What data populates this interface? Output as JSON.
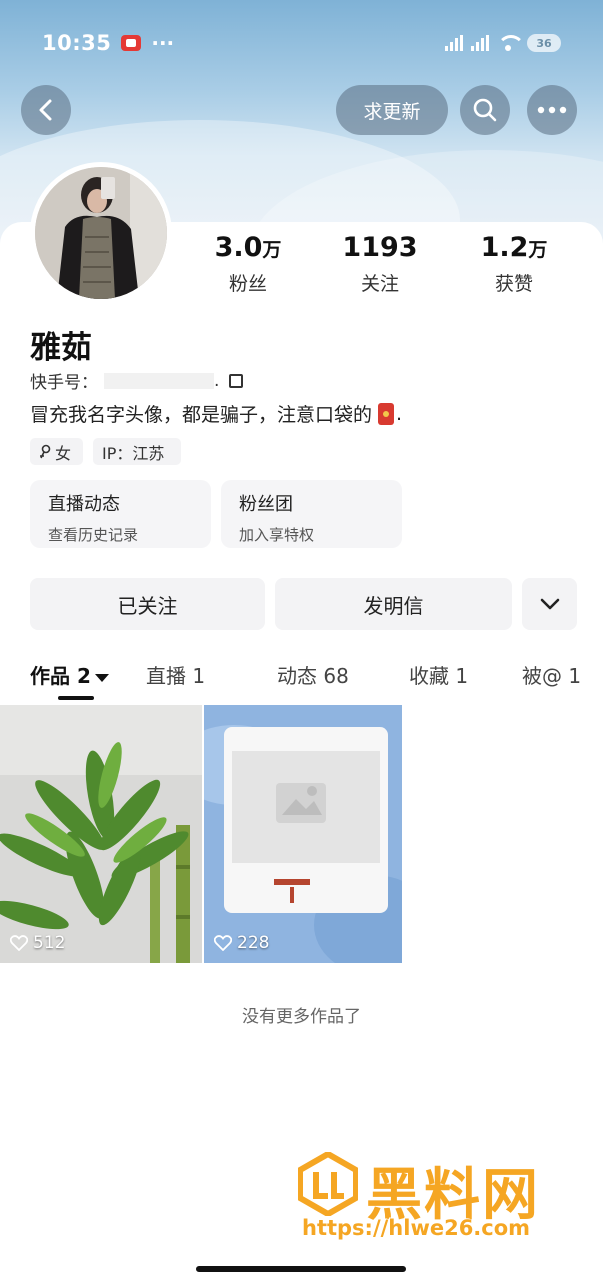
{
  "status_bar": {
    "time": "10:35",
    "dots": "···",
    "battery": "36"
  },
  "header": {
    "request_update_label": "求更新"
  },
  "profile": {
    "name": "雅茹",
    "account_label": "快手号：",
    "account_tail": ".",
    "bio": "冒充我名字头像，都是骗子，注意口袋的",
    "bio_end": ".",
    "stats": [
      {
        "num": "3.0",
        "unit": "万",
        "label": "粉丝"
      },
      {
        "num": "1193",
        "unit": "",
        "label": "关注"
      },
      {
        "num": "1.2",
        "unit": "万",
        "label": "获赞"
      }
    ],
    "tags": [
      {
        "icon": "female-icon",
        "label": "女"
      },
      {
        "label": "IP：江苏"
      }
    ]
  },
  "tiles": [
    {
      "title": "直播动态",
      "sub": "查看历史记录"
    },
    {
      "title": "粉丝团",
      "sub": "加入享特权"
    }
  ],
  "actions": {
    "followed_label": "已关注",
    "postcard_label": "发明信"
  },
  "tabs": [
    {
      "label": "作品 2",
      "active": true
    },
    {
      "label": "直播 1"
    },
    {
      "label": "动态 68"
    },
    {
      "label": "收藏 1"
    },
    {
      "label": "被@ 1"
    }
  ],
  "posts": [
    {
      "likes": "512",
      "subject": "bamboo-plant"
    },
    {
      "likes": "228",
      "subject": "screenshot-card"
    }
  ],
  "footer_text": "没有更多作品了",
  "watermark": {
    "title": "黑料网",
    "url": "https://hlwe26.com"
  },
  "colors": {
    "accent": "#f5a623",
    "header_top": "#7fb2d6",
    "red_packet": "#d83a30"
  }
}
